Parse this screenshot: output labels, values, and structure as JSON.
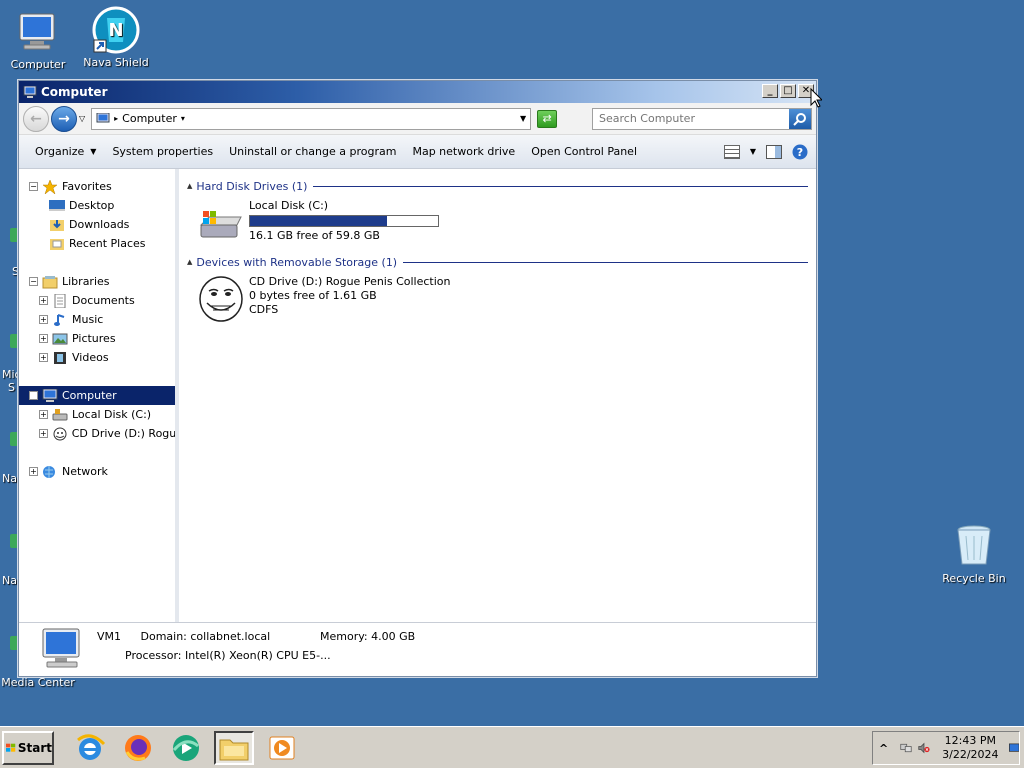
{
  "desktop": {
    "icons": [
      {
        "label": "Computer"
      },
      {
        "label": "Nava Shield"
      },
      {
        "label": "Recycle Bin"
      },
      {
        "label": "Media Center"
      }
    ],
    "edge_labels": [
      "S",
      "Mic",
      "S",
      "Nav",
      "Nav"
    ]
  },
  "window": {
    "title": "Computer",
    "controls": {
      "minimize": "_",
      "maximize": "□",
      "close": "✕"
    },
    "address": {
      "crumb": "Computer"
    },
    "search": {
      "placeholder": "Search Computer"
    },
    "toolbar": {
      "organize": "Organize",
      "system_properties": "System properties",
      "uninstall": "Uninstall or change a program",
      "map_drive": "Map network drive",
      "control_panel": "Open Control Panel"
    },
    "nav": {
      "favorites": "Favorites",
      "desktop": "Desktop",
      "downloads": "Downloads",
      "recent": "Recent Places",
      "libraries": "Libraries",
      "documents": "Documents",
      "music": "Music",
      "pictures": "Pictures",
      "videos": "Videos",
      "computer": "Computer",
      "local_disk": "Local Disk (C:)",
      "cd_drive": "CD Drive (D:) Rogue P",
      "network": "Network"
    },
    "groups": {
      "hdd": "Hard Disk Drives (1)",
      "removable": "Devices with Removable Storage (1)"
    },
    "drives": {
      "c": {
        "name": "Local Disk (C:)",
        "free": "16.1 GB free of 59.8 GB",
        "used_fraction": 0.73
      },
      "d": {
        "name": "CD Drive (D:) Rogue Penis Collection",
        "free": "0 bytes free of 1.61 GB",
        "fs": "CDFS"
      }
    },
    "details": {
      "name": "VM1",
      "domain": "Domain: collabnet.local",
      "memory": "Memory: 4.00 GB",
      "processor": "Processor: Intel(R) Xeon(R) CPU E5-..."
    }
  },
  "taskbar": {
    "start": "Start",
    "time": "12:43 PM",
    "date": "3/22/2024",
    "tray_expand": "^"
  },
  "colors": {
    "desktop": "#3a6ea5",
    "selection": "#0a246a",
    "group_header": "#1e3287"
  }
}
